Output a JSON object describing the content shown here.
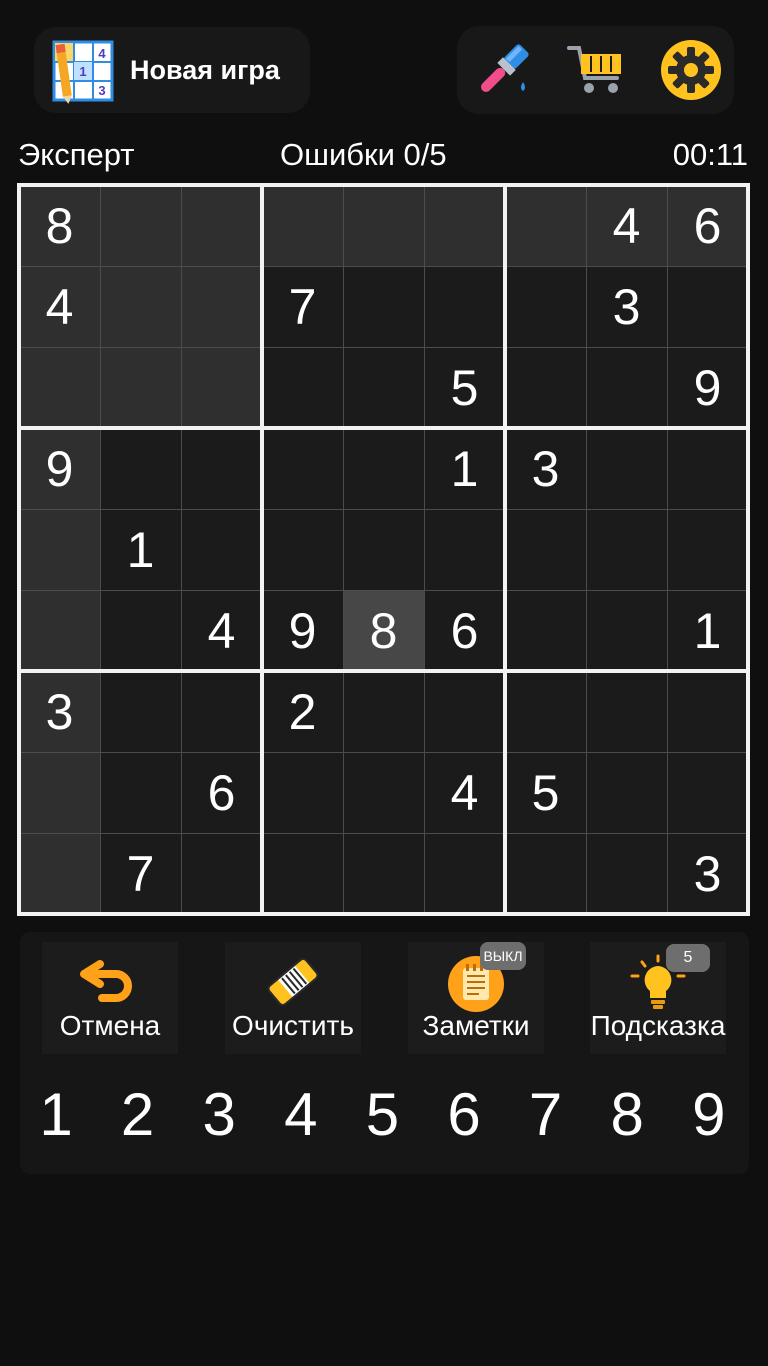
{
  "header": {
    "new_game_label": "Новая игра",
    "new_game_icon": "sudoku-grid-icon",
    "new_game_icon_digits": [
      "4",
      "1",
      "3"
    ],
    "tools": [
      "paintbrush-icon",
      "shopping-cart-icon",
      "gear-icon"
    ]
  },
  "status": {
    "difficulty": "Эксперт",
    "mistakes": "Ошибки 0/5",
    "timer": "00:11"
  },
  "board": {
    "rows": [
      [
        "8",
        "",
        "",
        "",
        "",
        "",
        "",
        "4",
        "6"
      ],
      [
        "4",
        "",
        "",
        "7",
        "",
        "",
        "",
        "3",
        ""
      ],
      [
        "",
        "",
        "",
        "",
        "",
        "5",
        "",
        "",
        "9"
      ],
      [
        "9",
        "",
        "",
        "",
        "",
        "1",
        "3",
        "",
        ""
      ],
      [
        "",
        "1",
        "",
        "",
        "",
        "",
        "",
        "",
        ""
      ],
      [
        "",
        "",
        "4",
        "9",
        "8",
        "6",
        "",
        "",
        "1"
      ],
      [
        "3",
        "",
        "",
        "2",
        "",
        "",
        "",
        "",
        ""
      ],
      [
        "",
        "",
        "6",
        "",
        "",
        "4",
        "5",
        "",
        ""
      ],
      [
        "",
        "7",
        "",
        "",
        "",
        "",
        "",
        "",
        "3"
      ]
    ],
    "selected_cell": [
      5,
      4
    ],
    "highlighted_cells": [
      [
        0,
        0
      ],
      [
        0,
        1
      ],
      [
        0,
        2
      ],
      [
        0,
        3
      ],
      [
        0,
        4
      ],
      [
        0,
        5
      ],
      [
        0,
        6
      ],
      [
        0,
        7
      ],
      [
        0,
        8
      ],
      [
        1,
        0
      ],
      [
        1,
        1
      ],
      [
        1,
        2
      ],
      [
        2,
        0
      ],
      [
        2,
        1
      ],
      [
        2,
        2
      ],
      [
        3,
        0
      ],
      [
        4,
        0
      ],
      [
        5,
        0
      ],
      [
        6,
        0
      ],
      [
        7,
        0
      ],
      [
        8,
        0
      ]
    ],
    "colors": {
      "background": "#1b1b1b",
      "highlight": "#2f2f2f",
      "selected": "#474747",
      "thin_line": "#4c4c4c",
      "thick_line": "#f2f2f2"
    }
  },
  "actions": {
    "undo": {
      "label": "Отмена",
      "icon": "undo-arrow-icon"
    },
    "erase": {
      "label": "Очистить",
      "icon": "eraser-icon"
    },
    "notes": {
      "label": "Заметки",
      "icon": "notepad-icon",
      "badge": "ВЫКЛ"
    },
    "hint": {
      "label": "Подсказка",
      "icon": "lightbulb-icon",
      "badge": "5"
    }
  },
  "numpad": [
    "1",
    "2",
    "3",
    "4",
    "5",
    "6",
    "7",
    "8",
    "9"
  ],
  "accent_colors": {
    "orange": "#ffa21a",
    "yellow": "#ffc21f"
  }
}
